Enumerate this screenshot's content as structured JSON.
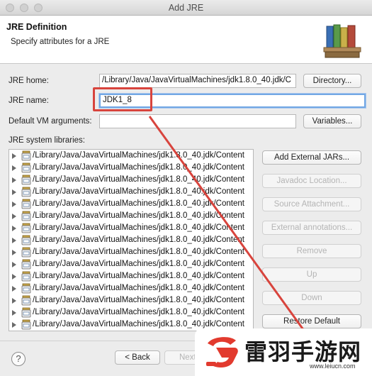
{
  "window": {
    "title": "Add JRE"
  },
  "header": {
    "title": "JRE Definition",
    "subtitle": "Specify attributes for a JRE"
  },
  "form": {
    "jre_home_label": "JRE home:",
    "jre_home_value": "/Library/Java/JavaVirtualMachines/jdk1.8.0_40.jdk/C",
    "directory_button": "Directory...",
    "jre_name_label": "JRE name:",
    "jre_name_value": "JDK1_8",
    "vm_args_label": "Default VM arguments:",
    "vm_args_value": "",
    "variables_button": "Variables...",
    "libraries_label": "JRE system libraries:"
  },
  "libraries": [
    "/Library/Java/JavaVirtualMachines/jdk1.8.0_40.jdk/Content",
    "/Library/Java/JavaVirtualMachines/jdk1.8.0_40.jdk/Content",
    "/Library/Java/JavaVirtualMachines/jdk1.8.0_40.jdk/Content",
    "/Library/Java/JavaVirtualMachines/jdk1.8.0_40.jdk/Content",
    "/Library/Java/JavaVirtualMachines/jdk1.8.0_40.jdk/Content",
    "/Library/Java/JavaVirtualMachines/jdk1.8.0_40.jdk/Content",
    "/Library/Java/JavaVirtualMachines/jdk1.8.0_40.jdk/Content",
    "/Library/Java/JavaVirtualMachines/jdk1.8.0_40.jdk/Content",
    "/Library/Java/JavaVirtualMachines/jdk1.8.0_40.jdk/Content",
    "/Library/Java/JavaVirtualMachines/jdk1.8.0_40.jdk/Content",
    "/Library/Java/JavaVirtualMachines/jdk1.8.0_40.jdk/Content",
    "/Library/Java/JavaVirtualMachines/jdk1.8.0_40.jdk/Content",
    "/Library/Java/JavaVirtualMachines/jdk1.8.0_40.jdk/Content",
    "/Library/Java/JavaVirtualMachines/jdk1.8.0_40.jdk/Content",
    "/Library/Java/JavaVirtualMachines/jdk1.8.0_40.jdk/Content"
  ],
  "side_buttons": {
    "add_external_jars": "Add External JARs...",
    "javadoc_location": "Javadoc Location...",
    "source_attachment": "Source Attachment...",
    "external_annotations": "External annotations...",
    "remove": "Remove",
    "up": "Up",
    "down": "Down",
    "restore_default": "Restore Default"
  },
  "footer": {
    "help": "?",
    "back": "< Back",
    "next": "Next"
  },
  "watermark": {
    "chinese": "雷羽手游网",
    "url": "www.leiucn.com"
  },
  "colors": {
    "annotation_red": "#d8443d",
    "focus_blue": "#72a7e4"
  }
}
